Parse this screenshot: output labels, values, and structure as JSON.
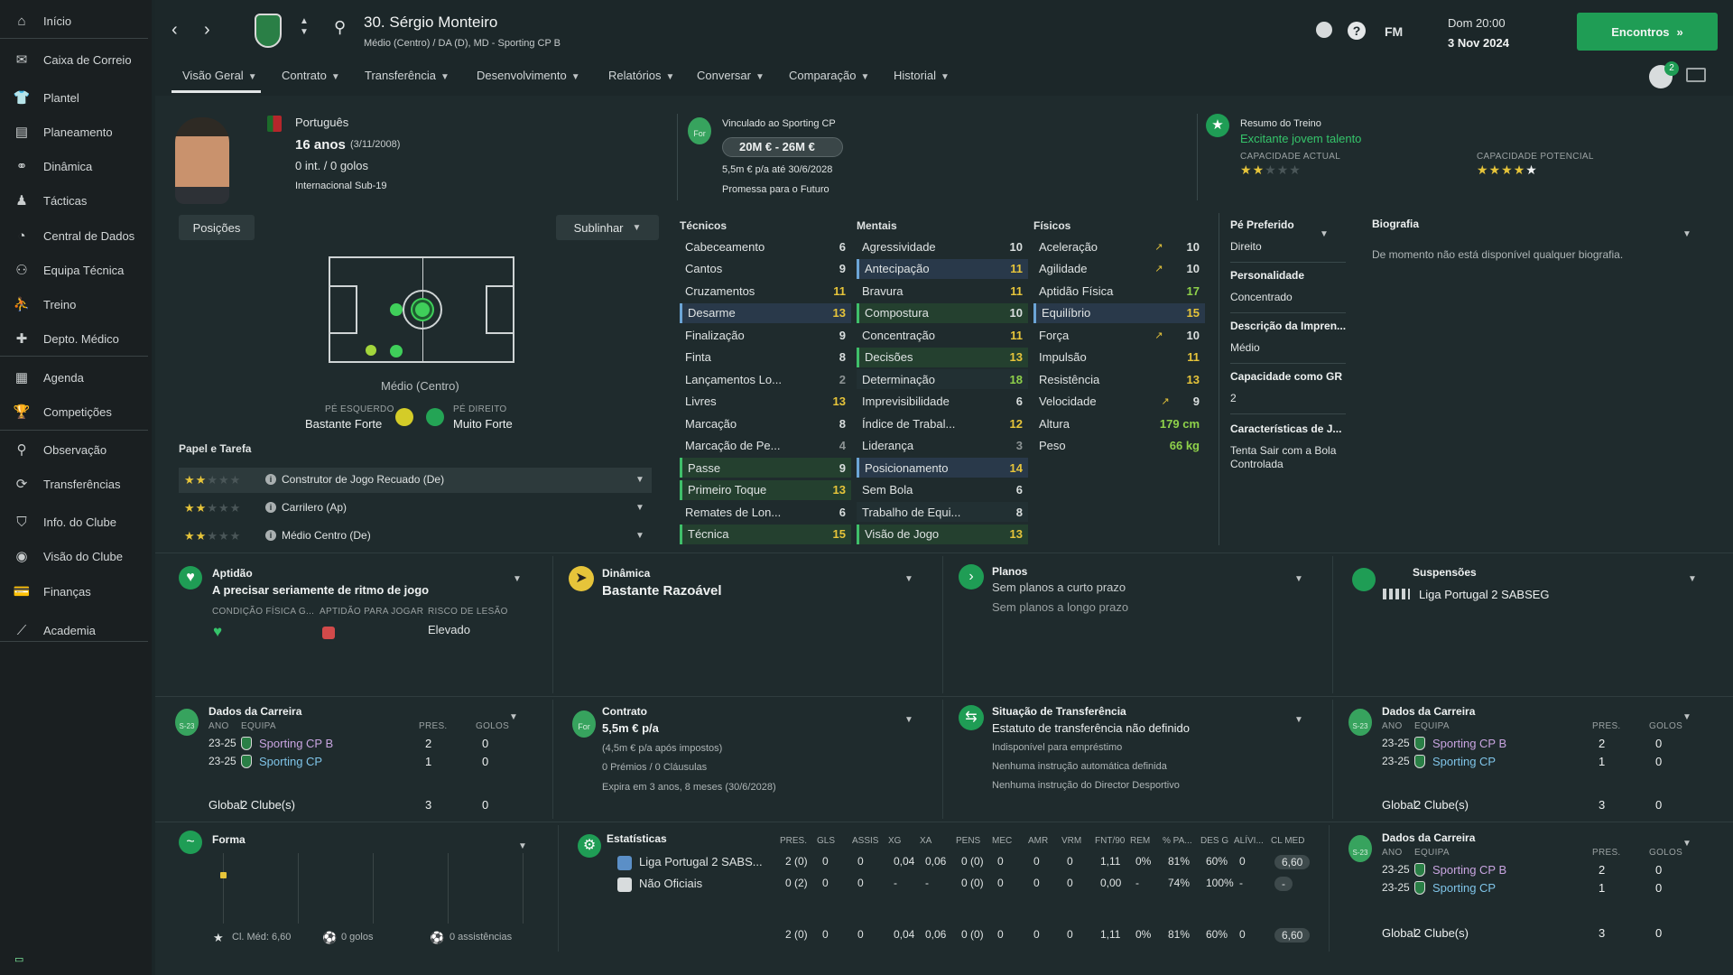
{
  "sidebar": {
    "items": [
      {
        "label": "Início",
        "icon": "home-icon"
      },
      {
        "label": "Caixa de Correio",
        "icon": "mail-icon"
      },
      {
        "label": "Plantel",
        "icon": "squad-icon"
      },
      {
        "label": "Planeamento",
        "icon": "clipboard-icon"
      },
      {
        "label": "Dinâmica",
        "icon": "dynamics-icon"
      },
      {
        "label": "Tácticas",
        "icon": "tactics-icon"
      },
      {
        "label": "Central de Dados",
        "icon": "data-icon"
      },
      {
        "label": "Equipa Técnica",
        "icon": "staff-icon"
      },
      {
        "label": "Treino",
        "icon": "training-icon"
      },
      {
        "label": "Depto. Médico",
        "icon": "medical-icon"
      },
      {
        "label": "Agenda",
        "icon": "calendar-icon"
      },
      {
        "label": "Competições",
        "icon": "trophy-icon"
      },
      {
        "label": "Observação",
        "icon": "scouting-icon"
      },
      {
        "label": "Transferências",
        "icon": "transfers-icon"
      },
      {
        "label": "Info. do Clube",
        "icon": "shield-icon"
      },
      {
        "label": "Visão do Clube",
        "icon": "vision-icon"
      },
      {
        "label": "Finanças",
        "icon": "finances-icon"
      },
      {
        "label": "Academia",
        "icon": "academy-icon"
      }
    ]
  },
  "header": {
    "player_title": "30. Sérgio Monteiro",
    "subtitle": "Médio (Centro) / DA (D), MD - Sporting CP B",
    "day_time": "Dom 20:00",
    "date": "3 Nov 2024",
    "continue_label": "Encontros",
    "fm_label": "FM",
    "notif_count": "2"
  },
  "tabs": [
    "Visão Geral",
    "Contrato",
    "Transferência",
    "Desenvolvimento",
    "Relatórios",
    "Conversar",
    "Comparação",
    "Historial"
  ],
  "profile": {
    "nationality": "Português",
    "age": "16 anos",
    "dob": "(3/11/2008)",
    "caps": "0 int. / 0 golos",
    "youth": "Internacional Sub-19",
    "contract_label": "Vinculado ao Sporting CP",
    "value": "20M € - 26M €",
    "wage": "5,5m € p/a até 30/6/2028",
    "status": "Promessa para o Futuro",
    "badge_for": "For",
    "training_label": "Resumo do Treino",
    "training_verdict": "Excitante jovem talento",
    "ca_label": "CAPACIDADE ACTUAL",
    "pa_label": "CAPACIDADE POTENCIAL",
    "ca_stars": 1.5,
    "pa_stars": 5
  },
  "positions": {
    "btn": "Posições",
    "highlight": "Sublinhar",
    "pos_label": "Médio (Centro)",
    "left_foot_label": "PÉ ESQUERDO",
    "left_foot": "Bastante Forte",
    "right_foot_label": "PÉ DIREITO",
    "right_foot": "Muito Forte"
  },
  "roles": {
    "title": "Papel e Tarefa",
    "items": [
      {
        "name": "Construtor de Jogo Recuado (De)",
        "stars": 1.5
      },
      {
        "name": "Carrilero (Ap)",
        "stars": 1.5
      },
      {
        "name": "Médio Centro (De)",
        "stars": 1.5
      }
    ]
  },
  "attributes": {
    "technical_title": "Técnicos",
    "mental_title": "Mentais",
    "physical_title": "Físicos",
    "technical": [
      [
        "Cabeceamento",
        "6"
      ],
      [
        "Cantos",
        "9"
      ],
      [
        "Cruzamentos",
        "11"
      ],
      [
        "Desarme",
        "13"
      ],
      [
        "Finalização",
        "9"
      ],
      [
        "Finta",
        "8"
      ],
      [
        "Lançamentos Lo...",
        "2"
      ],
      [
        "Livres",
        "13"
      ],
      [
        "Marcação",
        "8"
      ],
      [
        "Marcação de Pe...",
        "4"
      ],
      [
        "Passe",
        "9"
      ],
      [
        "Primeiro Toque",
        "13"
      ],
      [
        "Remates de Lon...",
        "6"
      ],
      [
        "Técnica",
        "15"
      ]
    ],
    "mental": [
      [
        "Agressividade",
        "10"
      ],
      [
        "Antecipação",
        "11"
      ],
      [
        "Bravura",
        "11"
      ],
      [
        "Compostura",
        "10"
      ],
      [
        "Concentração",
        "11"
      ],
      [
        "Decisões",
        "13"
      ],
      [
        "Determinação",
        "18"
      ],
      [
        "Imprevisibilidade",
        "6"
      ],
      [
        "Índice de Trabal...",
        "12"
      ],
      [
        "Liderança",
        "3"
      ],
      [
        "Posicionamento",
        "14"
      ],
      [
        "Sem Bola",
        "6"
      ],
      [
        "Trabalho de Equi...",
        "8"
      ],
      [
        "Visão de Jogo",
        "13"
      ]
    ],
    "physical": [
      [
        "Aceleração",
        "10"
      ],
      [
        "Agilidade",
        "10"
      ],
      [
        "Aptidão Física",
        "17"
      ],
      [
        "Equilíbrio",
        "15"
      ],
      [
        "Força",
        "10"
      ],
      [
        "Impulsão",
        "11"
      ],
      [
        "Resistência",
        "13"
      ],
      [
        "Velocidade",
        "9"
      ],
      [
        "Altura",
        "179 cm"
      ],
      [
        "Peso",
        "66 kg"
      ]
    ]
  },
  "side_info": [
    {
      "label": "Pé Preferido",
      "value": "Direito"
    },
    {
      "label": "Personalidade",
      "value": "Concentrado"
    },
    {
      "label": "Descrição da Impren...",
      "value": "Médio"
    },
    {
      "label": "Capacidade como GR",
      "value": "2"
    },
    {
      "label": "Características de J...",
      "value": "Tenta Sair com a Bola Controlada"
    }
  ],
  "bio": {
    "title": "Biografia",
    "text": "De momento não está disponível qualquer biografia."
  },
  "fitness": {
    "title": "Aptidão",
    "text": "A precisar seriamente de ritmo de jogo",
    "c1": "CONDIÇÃO FÍSICA G...",
    "c2": "APTIDÃO PARA JOGAR",
    "c3": "RISCO DE LESÃO",
    "risk": "Elevado"
  },
  "dynamics": {
    "title": "Dinâmica",
    "text": "Bastante Razoável"
  },
  "plans": {
    "title": "Planos",
    "short": "Sem planos a curto prazo",
    "long": "Sem planos a longo prazo"
  },
  "suspensions": {
    "title": "Suspensões",
    "league": "Liga Portugal 2 SABSEG"
  },
  "career": {
    "title": "Dados da Carreira",
    "h_year": "ANO",
    "h_team": "EQUIPA",
    "h_apps": "PRES.",
    "h_goals": "GOLOS",
    "rows": [
      [
        "23-25",
        "Sporting CP B",
        "2",
        "0"
      ],
      [
        "23-25",
        "Sporting CP",
        "1",
        "0"
      ]
    ],
    "total_label": "Global",
    "total_clubs": "2 Clube(s)",
    "total_apps": "3",
    "total_goals": "0",
    "badge": "S-23"
  },
  "contract": {
    "title": "Contrato",
    "wage": "5,5m € p/a",
    "after_tax": "(4,5m € p/a após impostos)",
    "clauses": "0 Prémios / 0 Cláusulas",
    "expires": "Expira em 3 anos, 8 meses (30/6/2028)",
    "badge": "For"
  },
  "transfer": {
    "title": "Situação de Transferência",
    "status": "Estatuto de transferência não definido",
    "l1": "Indisponível para empréstimo",
    "l2": "Nenhuma instrução automática definida",
    "l3": "Nenhuma instrução do Director Desportivo"
  },
  "form": {
    "title": "Forma",
    "avg": "Cl. Méd: 6,60",
    "goals": "0 golos",
    "assists": "0 assistências"
  },
  "stats": {
    "title": "Estatísticas",
    "headers": [
      "PRES.",
      "GLS",
      "ASSIS",
      "XG",
      "XA",
      "PENS",
      "MEC",
      "AMR",
      "VRM",
      "FNT/90",
      "REM",
      "% PA...",
      "DES G",
      "ALÍVI...",
      "CL MED"
    ],
    "rows": [
      {
        "comp": "Liga Portugal 2 SABS...",
        "vals": [
          "2 (0)",
          "0",
          "0",
          "0,04",
          "0,06",
          "0 (0)",
          "0",
          "0",
          "0",
          "1,11",
          "0%",
          "81%",
          "60%",
          "0",
          "6,60"
        ]
      },
      {
        "comp": "Não Oficiais",
        "vals": [
          "0 (2)",
          "0",
          "0",
          "-",
          "-",
          "0 (0)",
          "0",
          "0",
          "0",
          "0,00",
          "-",
          "74%",
          "100%",
          "-",
          "-"
        ]
      }
    ],
    "total": [
      "2 (0)",
      "0",
      "0",
      "0,04",
      "0,06",
      "0 (0)",
      "0",
      "0",
      "0",
      "1,11",
      "0%",
      "81%",
      "60%",
      "0",
      "6,60"
    ]
  },
  "colors": {
    "accent": "#1f9d55",
    "star": "#e6c43a",
    "highlight_blue": "#6ca5d6",
    "highlight_green": "#3fbf6a"
  }
}
